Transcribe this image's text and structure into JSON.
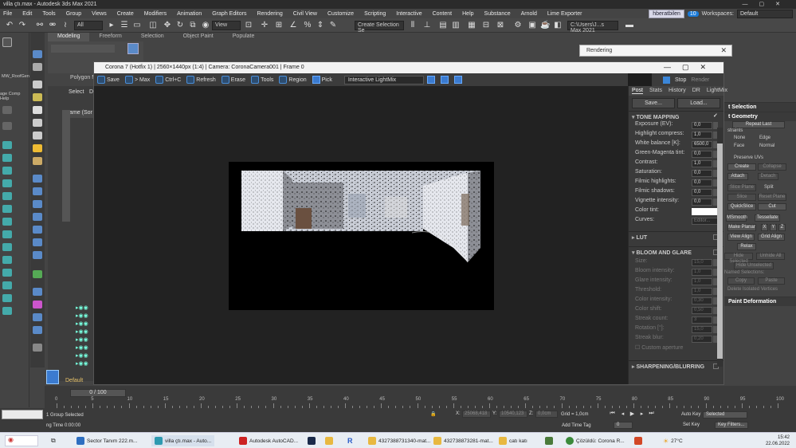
{
  "window_title": "villa çtı.max - Autodesk 3ds Max 2021",
  "menu": [
    "File",
    "Edit",
    "Tools",
    "Group",
    "Views",
    "Create",
    "Modifiers",
    "Animation",
    "Graph Editors",
    "Rendering",
    "Civil View",
    "Customize",
    "Scripting",
    "Interactive",
    "Content",
    "Help",
    "Substance",
    "Arnold",
    "Lime Exporter"
  ],
  "user": "hberatbilen",
  "notif_count": "10",
  "workspaces_label": "Workspaces:",
  "workspace": "Default",
  "toolbar": {
    "filter": "All",
    "view": "View",
    "selection_set": "Create Selection Se",
    "path": "C:\\Users\\J...s Max 2021"
  },
  "ribbon_tabs": [
    "Modeling",
    "Freeform",
    "Selection",
    "Object Paint",
    "Populate"
  ],
  "left_labels": {
    "polygon": "Polygon M",
    "mw": "MW_RoofGen",
    "page": "age Comp Help"
  },
  "scene_explorer": {
    "select": "Select",
    "di": "Di",
    "col": "Name (Sor"
  },
  "render_window": {
    "title": "Corona 7 (Hotfix 1) | 2560×1440px (1:4) | Camera: CoronaCamera001 | Frame 0",
    "tools": [
      "Save",
      "> Max",
      "Ctrl+C",
      "Refresh",
      "Erase",
      "Tools",
      "Region",
      "Pick"
    ],
    "mode": "Interactive LightMix",
    "stop": "Stop",
    "render": "Render"
  },
  "post_panel": {
    "tabs": [
      "Post",
      "Stats",
      "History",
      "DR",
      "LightMix"
    ],
    "save": "Save...",
    "load": "Load...",
    "tone_mapping": "TONE MAPPING",
    "tone_rows": [
      {
        "label": "Exposure (EV):",
        "value": "0,0"
      },
      {
        "label": "Highlight compress:",
        "value": "1,0"
      },
      {
        "label": "White balance [K]:",
        "value": "6500,0"
      },
      {
        "label": "Green-Magenta tint:",
        "value": "0,0"
      },
      {
        "label": "Contrast:",
        "value": "1,0"
      },
      {
        "label": "Saturation:",
        "value": "0,0"
      },
      {
        "label": "Filmic highlights:",
        "value": "0,0"
      },
      {
        "label": "Filmic shadows:",
        "value": "0,0"
      },
      {
        "label": "Vignette intensity:",
        "value": "0,0"
      }
    ],
    "color_tint": "Color tint:",
    "curves": "Curves:",
    "editor": "Editor...",
    "lut": "LUT",
    "bloom": "BLOOM AND GLARE",
    "bloom_rows": [
      {
        "label": "Size:",
        "value": "15,0"
      },
      {
        "label": "Bloom intensity:",
        "value": "1,0"
      },
      {
        "label": "Glare intensity:",
        "value": "1,0"
      },
      {
        "label": "Threshold:",
        "value": "1,0"
      },
      {
        "label": "Color intensity:",
        "value": "0,30"
      },
      {
        "label": "Color shift:",
        "value": "0,50"
      },
      {
        "label": "Streak count:",
        "value": "3"
      },
      {
        "label": "Rotation [°]:",
        "value": "15,0"
      },
      {
        "label": "Streak blur:",
        "value": "0,20"
      }
    ],
    "custom_aperture": "Custom aperture",
    "sharpening": "SHARPENING/BLURRING"
  },
  "floater_title": "Rendering",
  "command_panel": {
    "selection": "t Selection",
    "geometry": "t Geometry",
    "repeat_last": "Repeat Last",
    "constraints": "straints",
    "none": "None",
    "edge": "Edge",
    "face": "Face",
    "normal": "Normal",
    "preserve_uvs": "Preserve UVs",
    "create": "Create",
    "collapse": "Collapse",
    "attach": "Attach",
    "detach": "Detach",
    "slice_plane": "Slice Plane",
    "split": "Split",
    "slice": "Slice",
    "reset_plane": "Reset Plane",
    "quickslice": "QuickSlice",
    "cut": "Cut",
    "msmooth": "MSmooth",
    "tessellate": "Tessellate",
    "make_planar": "Make Planar",
    "x": "X",
    "y": "Y",
    "z": "Z",
    "view_align": "View Align",
    "grid_align": "Grid Align",
    "relax": "Relax",
    "hide_selected": "Hide Selected",
    "unhide_all": "Unhide All",
    "hide_unselected": "Hide Unselected",
    "named_selections": "Named Selections:",
    "copy": "Copy",
    "paste": "Paste",
    "delete_isolated": "Delete Isolated Vertices",
    "paint_deformation": "Paint Deformation"
  },
  "timeline": {
    "frame": "0 / 100",
    "ticks": [
      "0",
      "5",
      "10",
      "15",
      "20",
      "25",
      "30",
      "35",
      "40",
      "45",
      "50",
      "55",
      "60",
      "65",
      "70",
      "75",
      "80",
      "85",
      "90",
      "95",
      "100"
    ]
  },
  "status": {
    "selected": "1 Group Selected",
    "render_time": "ng Time 0:00:00",
    "x_label": "X:",
    "x_val": "25068,418",
    "y_label": "Y:",
    "y_val": "10540,123",
    "z_label": "Z:",
    "z_val": "0,0cm",
    "grid": "Grid = 1,0cm",
    "add_time_tag": "Add Time Tag",
    "auto_key": "Auto Key",
    "set_key": "Set Key",
    "selected_dd": "Selected",
    "key_filters": "Key Filters...",
    "frame_field": "0",
    "default": "Default"
  },
  "taskbar": {
    "items": [
      "Sector Tanım 222.m...",
      "villa çtı.max - Auto...",
      "Autodesk AutoCAD...",
      "",
      "",
      "4327388731340-mat...",
      "432738873281-mat...",
      "catı katı",
      "",
      "Çözüldü: Corona R...",
      ""
    ],
    "weather": "27°C",
    "time": "15:42",
    "date": "22.06.2022"
  }
}
